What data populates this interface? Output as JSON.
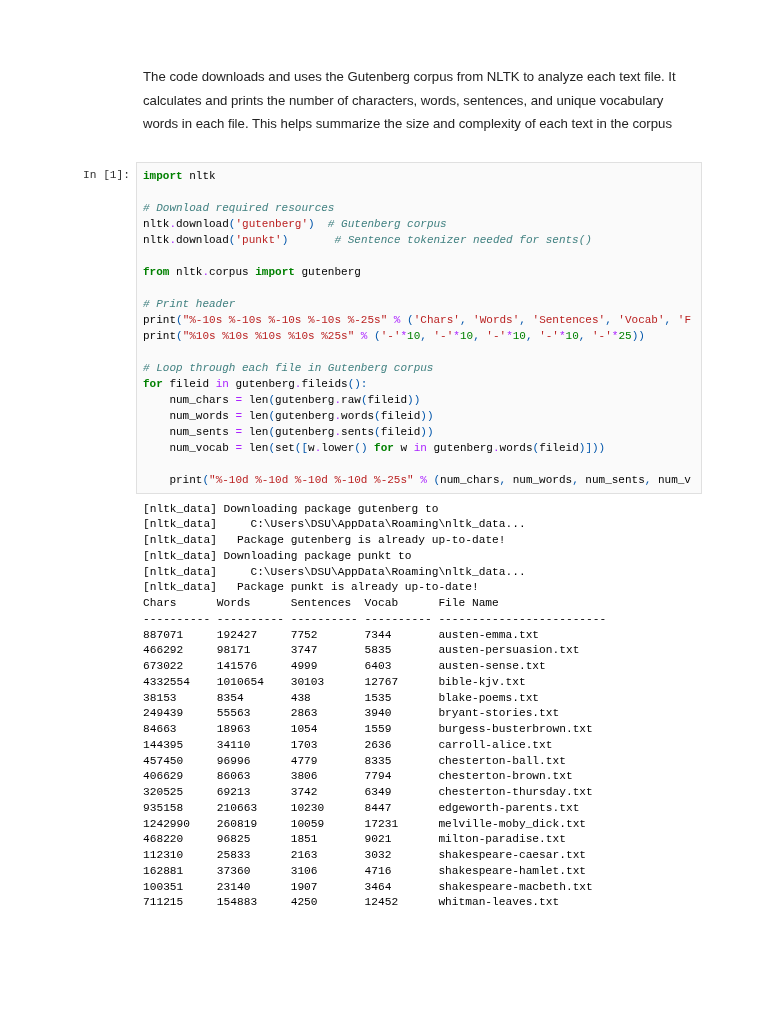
{
  "description": "The code downloads and uses the Gutenberg corpus from NLTK to analyze each text file. It calculates and prints the number of characters, words, sentences, and unique vocabulary words in each file. This helps summarize the size and complexity of each text in the corpus",
  "cell": {
    "prompt": "In [1]:",
    "lines": [
      {
        "tokens": [
          {
            "kind": "keyword",
            "text": "import"
          },
          {
            "kind": "plain",
            "text": " nltk"
          }
        ]
      },
      {
        "gap_before": true,
        "tokens": [
          {
            "kind": "comment",
            "text": "# Download required resources"
          }
        ]
      },
      {
        "tokens": [
          {
            "kind": "plain",
            "text": "nltk"
          },
          {
            "kind": "operator",
            "text": "."
          },
          {
            "kind": "plain",
            "text": "download"
          },
          {
            "kind": "punct",
            "text": "("
          },
          {
            "kind": "string",
            "text": "'gutenberg'"
          },
          {
            "kind": "punct",
            "text": ")"
          },
          {
            "kind": "comment",
            "text": "  # Gutenberg corpus"
          }
        ]
      },
      {
        "tokens": [
          {
            "kind": "plain",
            "text": "nltk"
          },
          {
            "kind": "operator",
            "text": "."
          },
          {
            "kind": "plain",
            "text": "download"
          },
          {
            "kind": "punct",
            "text": "("
          },
          {
            "kind": "string",
            "text": "'punkt'"
          },
          {
            "kind": "punct",
            "text": ")"
          },
          {
            "kind": "comment",
            "text": "       # Sentence tokenizer needed for sents()"
          }
        ]
      },
      {
        "gap_before": true,
        "tokens": [
          {
            "kind": "keyword",
            "text": "from"
          },
          {
            "kind": "plain",
            "text": " nltk"
          },
          {
            "kind": "operator",
            "text": "."
          },
          {
            "kind": "plain",
            "text": "corpus "
          },
          {
            "kind": "keyword",
            "text": "import"
          },
          {
            "kind": "plain",
            "text": " gutenberg"
          }
        ]
      },
      {
        "gap_before": true,
        "tokens": [
          {
            "kind": "comment",
            "text": "# Print header"
          }
        ]
      },
      {
        "tokens": [
          {
            "kind": "plain",
            "text": "print"
          },
          {
            "kind": "punct",
            "text": "("
          },
          {
            "kind": "string",
            "text": "\"%-10s %-10s %-10s %-10s %-25s\""
          },
          {
            "kind": "operator",
            "text": " % "
          },
          {
            "kind": "punct",
            "text": "("
          },
          {
            "kind": "string",
            "text": "'Chars'"
          },
          {
            "kind": "punct",
            "text": ", "
          },
          {
            "kind": "string",
            "text": "'Words'"
          },
          {
            "kind": "punct",
            "text": ", "
          },
          {
            "kind": "string",
            "text": "'Sentences'"
          },
          {
            "kind": "punct",
            "text": ", "
          },
          {
            "kind": "string",
            "text": "'Vocab'"
          },
          {
            "kind": "punct",
            "text": ", "
          },
          {
            "kind": "string",
            "text": "'F"
          }
        ]
      },
      {
        "tokens": [
          {
            "kind": "plain",
            "text": "print"
          },
          {
            "kind": "punct",
            "text": "("
          },
          {
            "kind": "string",
            "text": "\"%10s %10s %10s %10s %25s\""
          },
          {
            "kind": "operator",
            "text": " % "
          },
          {
            "kind": "punct",
            "text": "("
          },
          {
            "kind": "string",
            "text": "'-'"
          },
          {
            "kind": "operator",
            "text": "*"
          },
          {
            "kind": "number",
            "text": "10"
          },
          {
            "kind": "punct",
            "text": ", "
          },
          {
            "kind": "string",
            "text": "'-'"
          },
          {
            "kind": "operator",
            "text": "*"
          },
          {
            "kind": "number",
            "text": "10"
          },
          {
            "kind": "punct",
            "text": ", "
          },
          {
            "kind": "string",
            "text": "'-'"
          },
          {
            "kind": "operator",
            "text": "*"
          },
          {
            "kind": "number",
            "text": "10"
          },
          {
            "kind": "punct",
            "text": ", "
          },
          {
            "kind": "string",
            "text": "'-'"
          },
          {
            "kind": "operator",
            "text": "*"
          },
          {
            "kind": "number",
            "text": "10"
          },
          {
            "kind": "punct",
            "text": ", "
          },
          {
            "kind": "string",
            "text": "'-'"
          },
          {
            "kind": "operator",
            "text": "*"
          },
          {
            "kind": "number",
            "text": "25"
          },
          {
            "kind": "punct",
            "text": "))"
          }
        ]
      },
      {
        "gap_before": true,
        "tokens": [
          {
            "kind": "comment",
            "text": "# Loop through each file in Gutenberg corpus"
          }
        ]
      },
      {
        "tokens": [
          {
            "kind": "keyword",
            "text": "for"
          },
          {
            "kind": "plain",
            "text": " fileid "
          },
          {
            "kind": "operator",
            "text": "in"
          },
          {
            "kind": "plain",
            "text": " gutenberg"
          },
          {
            "kind": "operator",
            "text": "."
          },
          {
            "kind": "plain",
            "text": "fileids"
          },
          {
            "kind": "punct",
            "text": "():"
          }
        ]
      },
      {
        "tokens": [
          {
            "kind": "plain",
            "text": "    num_chars "
          },
          {
            "kind": "operator",
            "text": "="
          },
          {
            "kind": "plain",
            "text": " len"
          },
          {
            "kind": "punct",
            "text": "("
          },
          {
            "kind": "plain",
            "text": "gutenberg"
          },
          {
            "kind": "operator",
            "text": "."
          },
          {
            "kind": "plain",
            "text": "raw"
          },
          {
            "kind": "punct",
            "text": "("
          },
          {
            "kind": "plain",
            "text": "fileid"
          },
          {
            "kind": "punct",
            "text": "))"
          }
        ]
      },
      {
        "tokens": [
          {
            "kind": "plain",
            "text": "    num_words "
          },
          {
            "kind": "operator",
            "text": "="
          },
          {
            "kind": "plain",
            "text": " len"
          },
          {
            "kind": "punct",
            "text": "("
          },
          {
            "kind": "plain",
            "text": "gutenberg"
          },
          {
            "kind": "operator",
            "text": "."
          },
          {
            "kind": "plain",
            "text": "words"
          },
          {
            "kind": "punct",
            "text": "("
          },
          {
            "kind": "plain",
            "text": "fileid"
          },
          {
            "kind": "punct",
            "text": "))"
          }
        ]
      },
      {
        "tokens": [
          {
            "kind": "plain",
            "text": "    num_sents "
          },
          {
            "kind": "operator",
            "text": "="
          },
          {
            "kind": "plain",
            "text": " len"
          },
          {
            "kind": "punct",
            "text": "("
          },
          {
            "kind": "plain",
            "text": "gutenberg"
          },
          {
            "kind": "operator",
            "text": "."
          },
          {
            "kind": "plain",
            "text": "sents"
          },
          {
            "kind": "punct",
            "text": "("
          },
          {
            "kind": "plain",
            "text": "fileid"
          },
          {
            "kind": "punct",
            "text": "))"
          }
        ]
      },
      {
        "tokens": [
          {
            "kind": "plain",
            "text": "    num_vocab "
          },
          {
            "kind": "operator",
            "text": "="
          },
          {
            "kind": "plain",
            "text": " len"
          },
          {
            "kind": "punct",
            "text": "("
          },
          {
            "kind": "plain",
            "text": "set"
          },
          {
            "kind": "punct",
            "text": "(["
          },
          {
            "kind": "plain",
            "text": "w"
          },
          {
            "kind": "operator",
            "text": "."
          },
          {
            "kind": "plain",
            "text": "lower"
          },
          {
            "kind": "punct",
            "text": "()"
          },
          {
            "kind": "keyword",
            "text": " for"
          },
          {
            "kind": "plain",
            "text": " w "
          },
          {
            "kind": "operator",
            "text": "in"
          },
          {
            "kind": "plain",
            "text": " gutenberg"
          },
          {
            "kind": "operator",
            "text": "."
          },
          {
            "kind": "plain",
            "text": "words"
          },
          {
            "kind": "punct",
            "text": "("
          },
          {
            "kind": "plain",
            "text": "fileid"
          },
          {
            "kind": "punct",
            "text": ")]))"
          }
        ]
      },
      {
        "gap_before": true,
        "tokens": [
          {
            "kind": "plain",
            "text": "    print"
          },
          {
            "kind": "punct",
            "text": "("
          },
          {
            "kind": "string",
            "text": "\"%-10d %-10d %-10d %-10d %-25s\""
          },
          {
            "kind": "operator",
            "text": " % "
          },
          {
            "kind": "punct",
            "text": "("
          },
          {
            "kind": "plain",
            "text": "num_chars"
          },
          {
            "kind": "punct",
            "text": ", "
          },
          {
            "kind": "plain",
            "text": "num_words"
          },
          {
            "kind": "punct",
            "text": ", "
          },
          {
            "kind": "plain",
            "text": "num_sents"
          },
          {
            "kind": "punct",
            "text": ", "
          },
          {
            "kind": "plain",
            "text": "num_v"
          }
        ]
      }
    ]
  },
  "output": {
    "log": [
      "[nltk_data] Downloading package gutenberg to",
      "[nltk_data]     C:\\Users\\DSU\\AppData\\Roaming\\nltk_data...",
      "[nltk_data]   Package gutenberg is already up-to-date!",
      "[nltk_data] Downloading package punkt to",
      "[nltk_data]     C:\\Users\\DSU\\AppData\\Roaming\\nltk_data...",
      "[nltk_data]   Package punkt is already up-to-date!"
    ],
    "columns": [
      "Chars",
      "Words",
      "Sentences",
      "Vocab",
      "File Name"
    ],
    "rules": [
      "----------",
      "----------",
      "----------",
      "----------",
      "-------------------------"
    ],
    "rows": [
      [
        "887071",
        "192427",
        "7752",
        "7344",
        "austen-emma.txt"
      ],
      [
        "466292",
        "98171",
        "3747",
        "5835",
        "austen-persuasion.txt"
      ],
      [
        "673022",
        "141576",
        "4999",
        "6403",
        "austen-sense.txt"
      ],
      [
        "4332554",
        "1010654",
        "30103",
        "12767",
        "bible-kjv.txt"
      ],
      [
        "38153",
        "8354",
        "438",
        "1535",
        "blake-poems.txt"
      ],
      [
        "249439",
        "55563",
        "2863",
        "3940",
        "bryant-stories.txt"
      ],
      [
        "84663",
        "18963",
        "1054",
        "1559",
        "burgess-busterbrown.txt"
      ],
      [
        "144395",
        "34110",
        "1703",
        "2636",
        "carroll-alice.txt"
      ],
      [
        "457450",
        "96996",
        "4779",
        "8335",
        "chesterton-ball.txt"
      ],
      [
        "406629",
        "86063",
        "3806",
        "7794",
        "chesterton-brown.txt"
      ],
      [
        "320525",
        "69213",
        "3742",
        "6349",
        "chesterton-thursday.txt"
      ],
      [
        "935158",
        "210663",
        "10230",
        "8447",
        "edgeworth-parents.txt"
      ],
      [
        "1242990",
        "260819",
        "10059",
        "17231",
        "melville-moby_dick.txt"
      ],
      [
        "468220",
        "96825",
        "1851",
        "9021",
        "milton-paradise.txt"
      ],
      [
        "112310",
        "25833",
        "2163",
        "3032",
        "shakespeare-caesar.txt"
      ],
      [
        "162881",
        "37360",
        "3106",
        "4716",
        "shakespeare-hamlet.txt"
      ],
      [
        "100351",
        "23140",
        "1907",
        "3464",
        "shakespeare-macbeth.txt"
      ],
      [
        "711215",
        "154883",
        "4250",
        "12452",
        "whitman-leaves.txt"
      ]
    ]
  }
}
